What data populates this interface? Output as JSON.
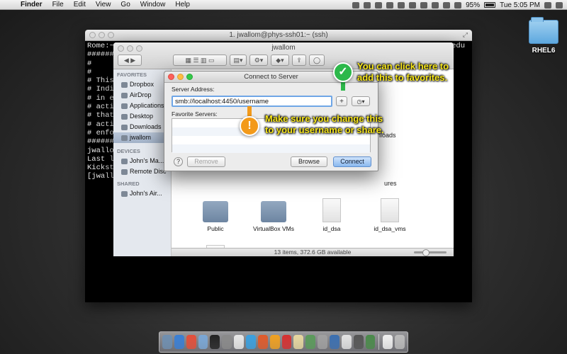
{
  "menubar": {
    "apple": "",
    "app": "Finder",
    "items": [
      "File",
      "Edit",
      "View",
      "Go",
      "Window",
      "Help"
    ],
    "battery": "95%",
    "clock": "Tue 5:05 PM"
  },
  "desktop": {
    "folder_label": "RHEL6"
  },
  "terminal": {
    "title": "1. jwallom@phys-ssh01:~ (ssh)",
    "edu_fragment": "edu",
    "lines": [
      "Rome:~",
      "######",
      "#",
      "#",
      "# This",
      "# Indiv",
      "# in ex",
      "# activ",
      "# that",
      "# activ",
      "# enfor",
      "######",
      "jwallo",
      "Last lo",
      "Kicksta",
      "[jwallo"
    ]
  },
  "finder": {
    "title": "jwallom",
    "sidebar": {
      "favorites_header": "FAVORITES",
      "favorites": [
        "Dropbox",
        "AirDrop",
        "Applications",
        "Desktop",
        "Downloads",
        "jwallom"
      ],
      "devices_header": "DEVICES",
      "devices": [
        "John's Ma...",
        "Remote Disc"
      ],
      "shared_header": "SHARED",
      "shared": [
        "John's Air..."
      ]
    },
    "partial_downloads": "nloads",
    "partial_pictures": "ures",
    "items": [
      "Public",
      "VirtualBox VMs",
      "id_dsa",
      "id_dsa_vms"
    ],
    "status": "13 items, 372.6 GB available"
  },
  "dialog": {
    "title": "Connect to Server",
    "server_label": "Server Address:",
    "server_value": "smb://localhost:4450/username",
    "add_button": "+",
    "recent_button": "◷▾",
    "favorites_label": "Favorite Servers:",
    "help": "?",
    "remove": "Remove",
    "browse": "Browse",
    "connect": "Connect"
  },
  "callouts": {
    "add_tip": [
      "You can click here to",
      "add this to favorites."
    ],
    "name_tip": [
      "Make sure you change this",
      "to your username or share."
    ],
    "check_glyph": "✓",
    "warn_glyph": "!"
  },
  "dock": {
    "colors": [
      "#6f8fb0",
      "#3a7fd5",
      "#e34f3a",
      "#7aa7d6",
      "#222222",
      "#8a8a8a",
      "#e8e8e8",
      "#3aa0e0",
      "#e05a2a",
      "#f0a020",
      "#d63030",
      "#e7d7a0",
      "#5a9a5a",
      "#a0a0a0",
      "#3b6fb0",
      "#e2e2e2",
      "#555555",
      "#4a8a4a",
      "#f0f0f0",
      "#bbbbbb"
    ]
  }
}
